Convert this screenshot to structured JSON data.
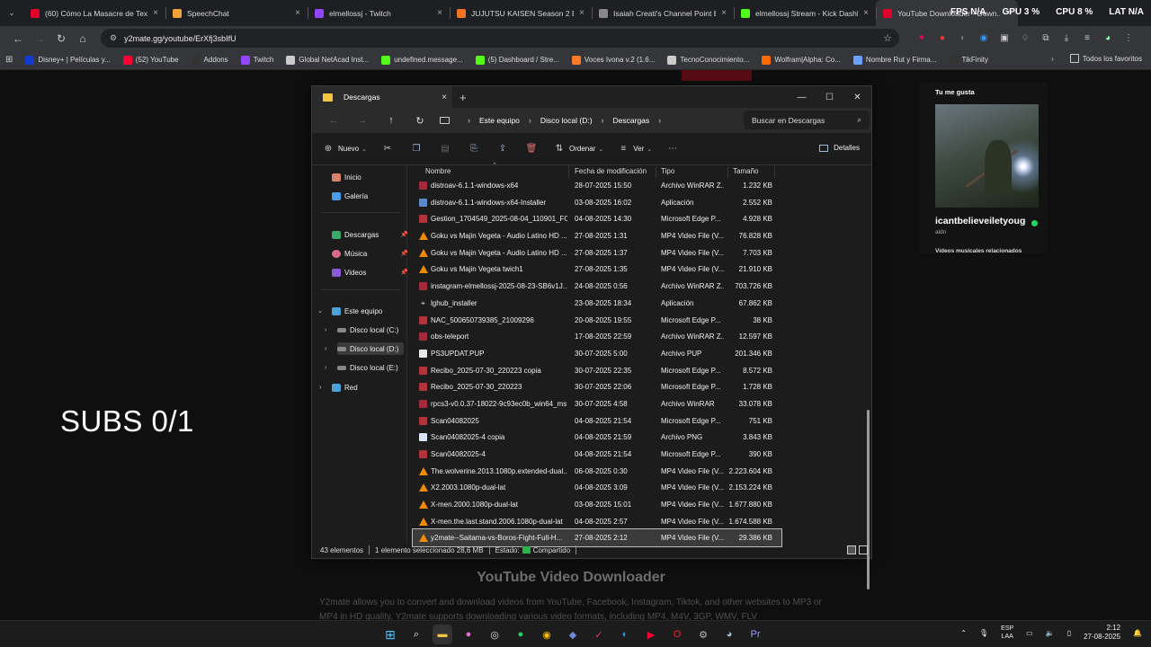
{
  "browser": {
    "tabs": [
      {
        "title": "(60) Cómo La Masacre de Texas...",
        "color": "#e0002a"
      },
      {
        "title": "SpeechChat",
        "color": "#f2a33a"
      },
      {
        "title": "elmellossj - Twitch",
        "color": "#9146ff"
      },
      {
        "title": "JUJUTSU KAISEN Season 2 El b...",
        "color": "#f47521"
      },
      {
        "title": "Isaiah Creati's Channel Point Bo...",
        "color": "#888888"
      },
      {
        "title": "elmellossj Stream - Kick Dashb...",
        "color": "#53fc18"
      },
      {
        "title": "YouTube Downloader - Down...",
        "color": "#e0002a"
      }
    ],
    "overlay": {
      "fps": "FPS N/A",
      "gpu": "GPU 3 %",
      "cpu": "CPU 8 %",
      "lat": "LAT N/A"
    },
    "url": "y2mate.gg/youtube/ErXfj3sbIfU",
    "bookmarks": [
      "Disney+ | Películas y...",
      "(52) YouTube",
      "Addons",
      "Twitch",
      "Global NetAcad Inst...",
      "undefined.message...",
      "(5) Dashboard / Stre...",
      "Voces Ivona v.2 (1.6...",
      "TecnoConocimiento...",
      "Wolfram|Alpha: Co...",
      "Nombre Rut y Firma...",
      "TikFinity"
    ],
    "all_bookmarks": "Todos los favoritos"
  },
  "page": {
    "subs": "SUBS 0/1",
    "heading": "YouTube Video Downloader",
    "description": "Y2mate allows you to convert and download videos from YouTube, Facebook, Instagram, Tiktok, and other websites to MP3 or MP4 in HD quality. Y2mate supports downloading various video formats, including MP4, M4V, 3GP, WMV, FLV"
  },
  "spotify": {
    "title": "Tu me gusta",
    "artist": "icantbelieveiletyougo",
    "sub": "aldn",
    "related": "Videos musicales relacionados"
  },
  "explorer": {
    "tab_title": "Descargas",
    "breadcrumb": [
      "Este equipo",
      "Disco local (D:)",
      "Descargas"
    ],
    "search_placeholder": "Buscar en Descargas",
    "commands": {
      "new": "Nuevo",
      "sort": "Ordenar",
      "view": "Ver",
      "details": "Detalles"
    },
    "nav": {
      "home": "Inicio",
      "gallery": "Galería",
      "downloads": "Descargas",
      "music": "Música",
      "videos": "Videos",
      "this_pc": "Este equipo",
      "disk_c": "Disco local (C:)",
      "disk_d": "Disco local (D:)",
      "disk_e": "Disco local (E:)",
      "network": "Red"
    },
    "columns": {
      "name": "Nombre",
      "date": "Fecha de modificación",
      "type": "Tipo",
      "size": "Tamaño"
    },
    "files": [
      {
        "name": "distroav-6.1.1-windows-x64",
        "date": "28-07-2025 15:50",
        "type": "Archivo WinRAR Z...",
        "size": "1.232 KB",
        "icon": "rar"
      },
      {
        "name": "distroav-6.1.1-windows-x64-Installer",
        "date": "03-08-2025 16:02",
        "type": "Aplicación",
        "size": "2.552 KB",
        "icon": "exe"
      },
      {
        "name": "Gestion_1704549_2025-08-04_110901_FO...",
        "date": "04-08-2025 14:30",
        "type": "Microsoft Edge P...",
        "size": "4.928 KB",
        "icon": "edge"
      },
      {
        "name": "Goku vs Majin Vegeta - Audio Latino HD ...",
        "date": "27-08-2025 1:31",
        "type": "MP4 Video File (V...",
        "size": "76.828 KB",
        "icon": "vlc"
      },
      {
        "name": "Goku vs Majin Vegeta - Audio Latino HD ...",
        "date": "27-08-2025 1:37",
        "type": "MP4 Video File (V...",
        "size": "7.703 KB",
        "icon": "vlc"
      },
      {
        "name": "Goku vs Majin Vegeta  twich1",
        "date": "27-08-2025 1:35",
        "type": "MP4 Video File (V...",
        "size": "21.910 KB",
        "icon": "vlc"
      },
      {
        "name": "instagram-elmellossj-2025-08-23-SB6v1J...",
        "date": "24-08-2025 0:56",
        "type": "Archivo WinRAR Z...",
        "size": "703.726 KB",
        "icon": "rar"
      },
      {
        "name": "lghub_installer",
        "date": "23-08-2025 18:34",
        "type": "Aplicación",
        "size": "67.862 KB",
        "icon": "lg"
      },
      {
        "name": "NAC_500650739385_21009296",
        "date": "20-08-2025 19:55",
        "type": "Microsoft Edge P...",
        "size": "38 KB",
        "icon": "edge"
      },
      {
        "name": "obs-teleport",
        "date": "17-08-2025 22:59",
        "type": "Archivo WinRAR Z...",
        "size": "12.597 KB",
        "icon": "rar"
      },
      {
        "name": "PS3UPDAT.PUP",
        "date": "30-07-2025 5:00",
        "type": "Archivo PUP",
        "size": "201.346 KB",
        "icon": "doc"
      },
      {
        "name": "Recibo_2025-07-30_220223 copia",
        "date": "30-07-2025 22:35",
        "type": "Microsoft Edge P...",
        "size": "8.572 KB",
        "icon": "edge"
      },
      {
        "name": "Recibo_2025-07-30_220223",
        "date": "30-07-2025 22:06",
        "type": "Microsoft Edge P...",
        "size": "1.728 KB",
        "icon": "edge"
      },
      {
        "name": "rpcs3-v0.0.37-18022-9c93ec0b_win64_ms...",
        "date": "30-07-2025 4:58",
        "type": "Archivo WinRAR",
        "size": "33.078 KB",
        "icon": "rar"
      },
      {
        "name": "Scan04082025",
        "date": "04-08-2025 21:54",
        "type": "Microsoft Edge P...",
        "size": "751 KB",
        "icon": "edge"
      },
      {
        "name": "Scan04082025-4 copia",
        "date": "04-08-2025 21:59",
        "type": "Archivo PNG",
        "size": "3.843 KB",
        "icon": "png"
      },
      {
        "name": "Scan04082025-4",
        "date": "04-08-2025 21:54",
        "type": "Microsoft Edge P...",
        "size": "390 KB",
        "icon": "edge"
      },
      {
        "name": "The.wolverine.2013.1080p.extended-dual...",
        "date": "06-08-2025 0:30",
        "type": "MP4 Video File (V...",
        "size": "2.223.604 KB",
        "icon": "vlc"
      },
      {
        "name": "X2.2003.1080p-dual-lat",
        "date": "04-08-2025 3:09",
        "type": "MP4 Video File (V...",
        "size": "2.153.224 KB",
        "icon": "vlc"
      },
      {
        "name": "X-men.2000.1080p-dual-lat",
        "date": "03-08-2025 15:01",
        "type": "MP4 Video File (V...",
        "size": "1.677.880 KB",
        "icon": "vlc"
      },
      {
        "name": "X-men.the.last.stand.2006.1080p-dual-lat",
        "date": "04-08-2025 2:57",
        "type": "MP4 Video File (V...",
        "size": "1.674.588 KB",
        "icon": "vlc"
      },
      {
        "name": "y2mate--Saitama-vs-Boros-Fight-Full-H...",
        "date": "27-08-2025 2:12",
        "type": "MP4 Video File (V...",
        "size": "29.386 KB",
        "icon": "vlc",
        "selected": true
      }
    ],
    "status": {
      "count": "43 elementos",
      "selection": "1 elemento seleccionado  28,6 MB",
      "state_label": "Estado:",
      "state": "Compartido"
    }
  },
  "taskbar": {
    "lang_top": "ESP",
    "lang_bottom": "LAA",
    "time": "2:12",
    "date": "27-08-2025"
  }
}
